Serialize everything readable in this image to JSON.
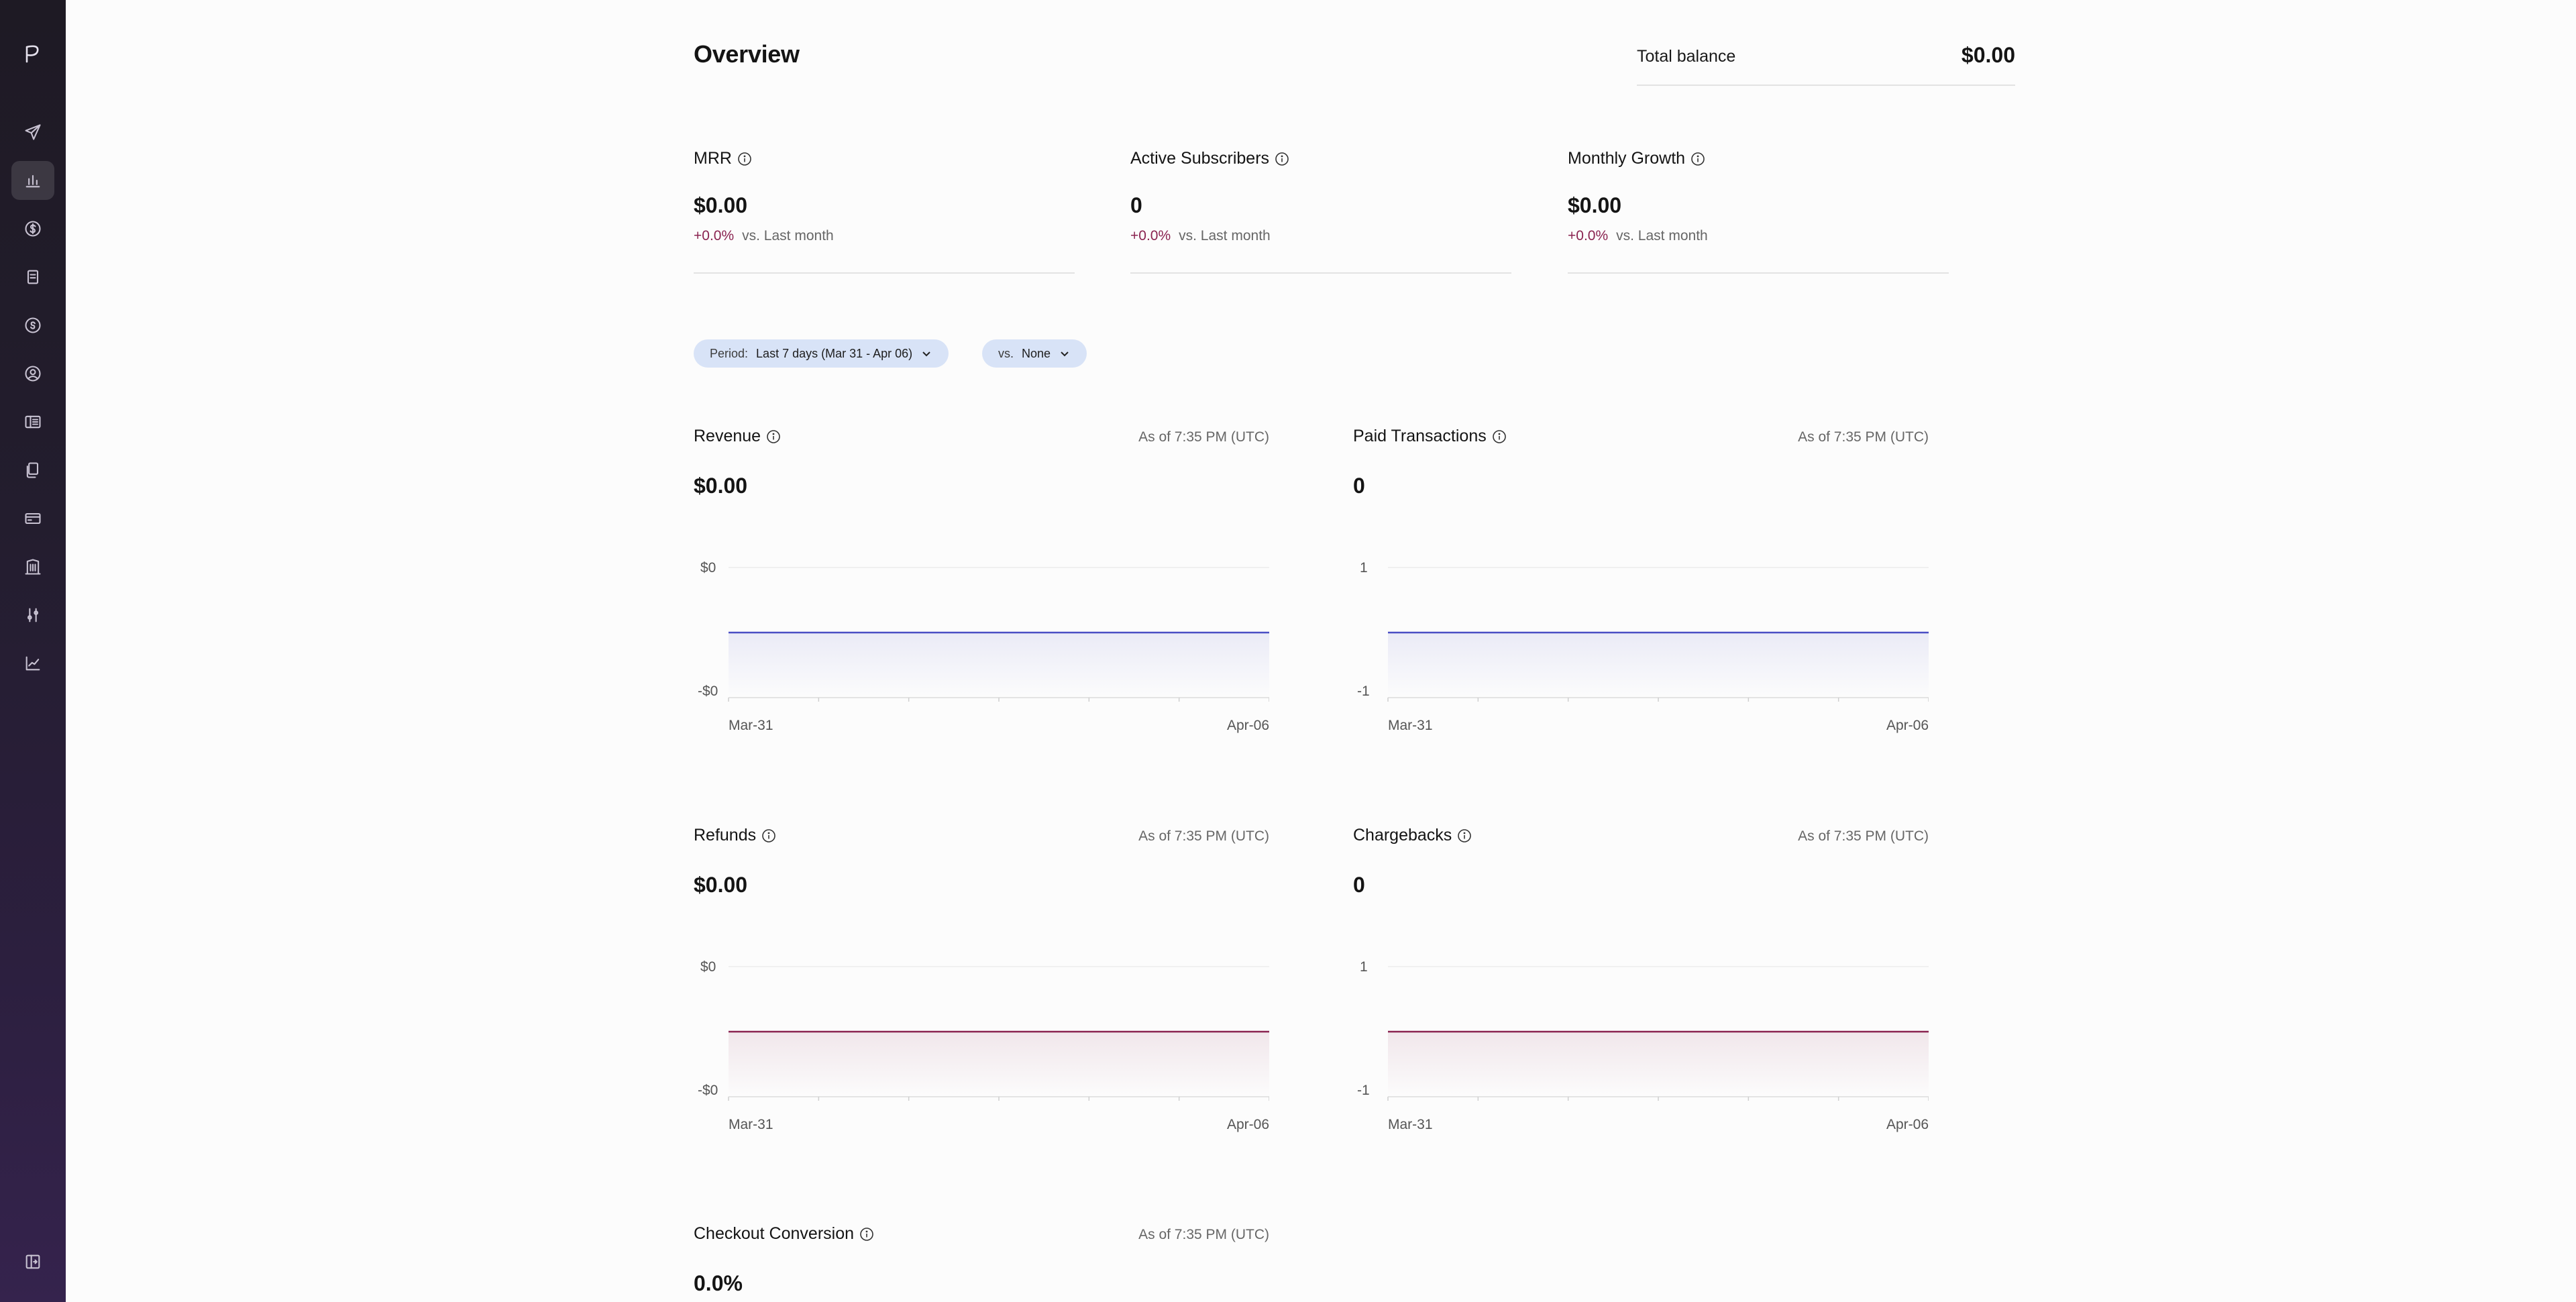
{
  "header": {
    "title": "Overview",
    "balance_label": "Total balance",
    "balance_value": "$0.00"
  },
  "metrics": [
    {
      "label": "MRR",
      "value": "$0.00",
      "delta": "+0.0%",
      "comparison": "vs. Last month"
    },
    {
      "label": "Active Subscribers",
      "value": "0",
      "delta": "+0.0%",
      "comparison": "vs. Last month"
    },
    {
      "label": "Monthly Growth",
      "value": "$0.00",
      "delta": "+0.0%",
      "comparison": "vs. Last month"
    }
  ],
  "filters": {
    "period_prefix": "Period:",
    "period_value": "Last 7 days (Mar 31 - Apr 06)",
    "compare_prefix": "vs.",
    "compare_value": "None"
  },
  "cards": [
    {
      "title": "Revenue",
      "as_of": "As of 7:35 PM (UTC)",
      "value": "$0.00"
    },
    {
      "title": "Paid Transactions",
      "as_of": "As of 7:35 PM (UTC)",
      "value": "0"
    },
    {
      "title": "Refunds",
      "as_of": "As of 7:35 PM (UTC)",
      "value": "$0.00"
    },
    {
      "title": "Chargebacks",
      "as_of": "As of 7:35 PM (UTC)",
      "value": "0"
    },
    {
      "title": "Checkout Conversion",
      "as_of": "As of 7:35 PM (UTC)",
      "value": "0.0%"
    }
  ],
  "colors": {
    "revenue_line": "#4b4fc4",
    "refund_line": "#8a2350",
    "delta_text": "#8a2350",
    "pill_bg": "#d8e3f7"
  },
  "chart_data": [
    {
      "type": "area",
      "x": [
        "Mar-31",
        "Apr-06"
      ],
      "series": [
        {
          "values": [
            0,
            0,
            0,
            0,
            0,
            0,
            0
          ]
        }
      ],
      "y_ticks": [
        "$0",
        "-$0"
      ],
      "ylim": [
        -1,
        1
      ],
      "grid": true
    },
    {
      "type": "area",
      "x": [
        "Mar-31",
        "Apr-06"
      ],
      "series": [
        {
          "values": [
            0,
            0,
            0,
            0,
            0,
            0,
            0
          ]
        }
      ],
      "y_ticks": [
        "1",
        "-1"
      ],
      "ylim": [
        -1,
        1
      ],
      "grid": true
    },
    {
      "type": "area",
      "x": [
        "Mar-31",
        "Apr-06"
      ],
      "series": [
        {
          "values": [
            0,
            0,
            0,
            0,
            0,
            0,
            0
          ]
        }
      ],
      "y_ticks": [
        "$0",
        "-$0"
      ],
      "ylim": [
        -1,
        1
      ],
      "grid": true
    },
    {
      "type": "area",
      "x": [
        "Mar-31",
        "Apr-06"
      ],
      "series": [
        {
          "values": [
            0,
            0,
            0,
            0,
            0,
            0,
            0
          ]
        }
      ],
      "y_ticks": [
        "1",
        "-1"
      ],
      "ylim": [
        -1,
        1
      ],
      "grid": true
    }
  ],
  "sidebar": {
    "logo_icon": "polar-logo-icon",
    "items": [
      {
        "icon": "rocket-icon"
      },
      {
        "icon": "bar-chart-icon",
        "active": true
      },
      {
        "icon": "dollar-circle-icon"
      },
      {
        "icon": "documents-icon"
      },
      {
        "icon": "coin-icon"
      },
      {
        "icon": "user-circle-icon"
      },
      {
        "icon": "book-icon"
      },
      {
        "icon": "files-icon"
      },
      {
        "icon": "credit-card-icon"
      },
      {
        "icon": "building-icon"
      },
      {
        "icon": "sliders-icon"
      },
      {
        "icon": "trend-chart-icon"
      }
    ],
    "bottom_icon": "collapse-sidebar-icon"
  }
}
